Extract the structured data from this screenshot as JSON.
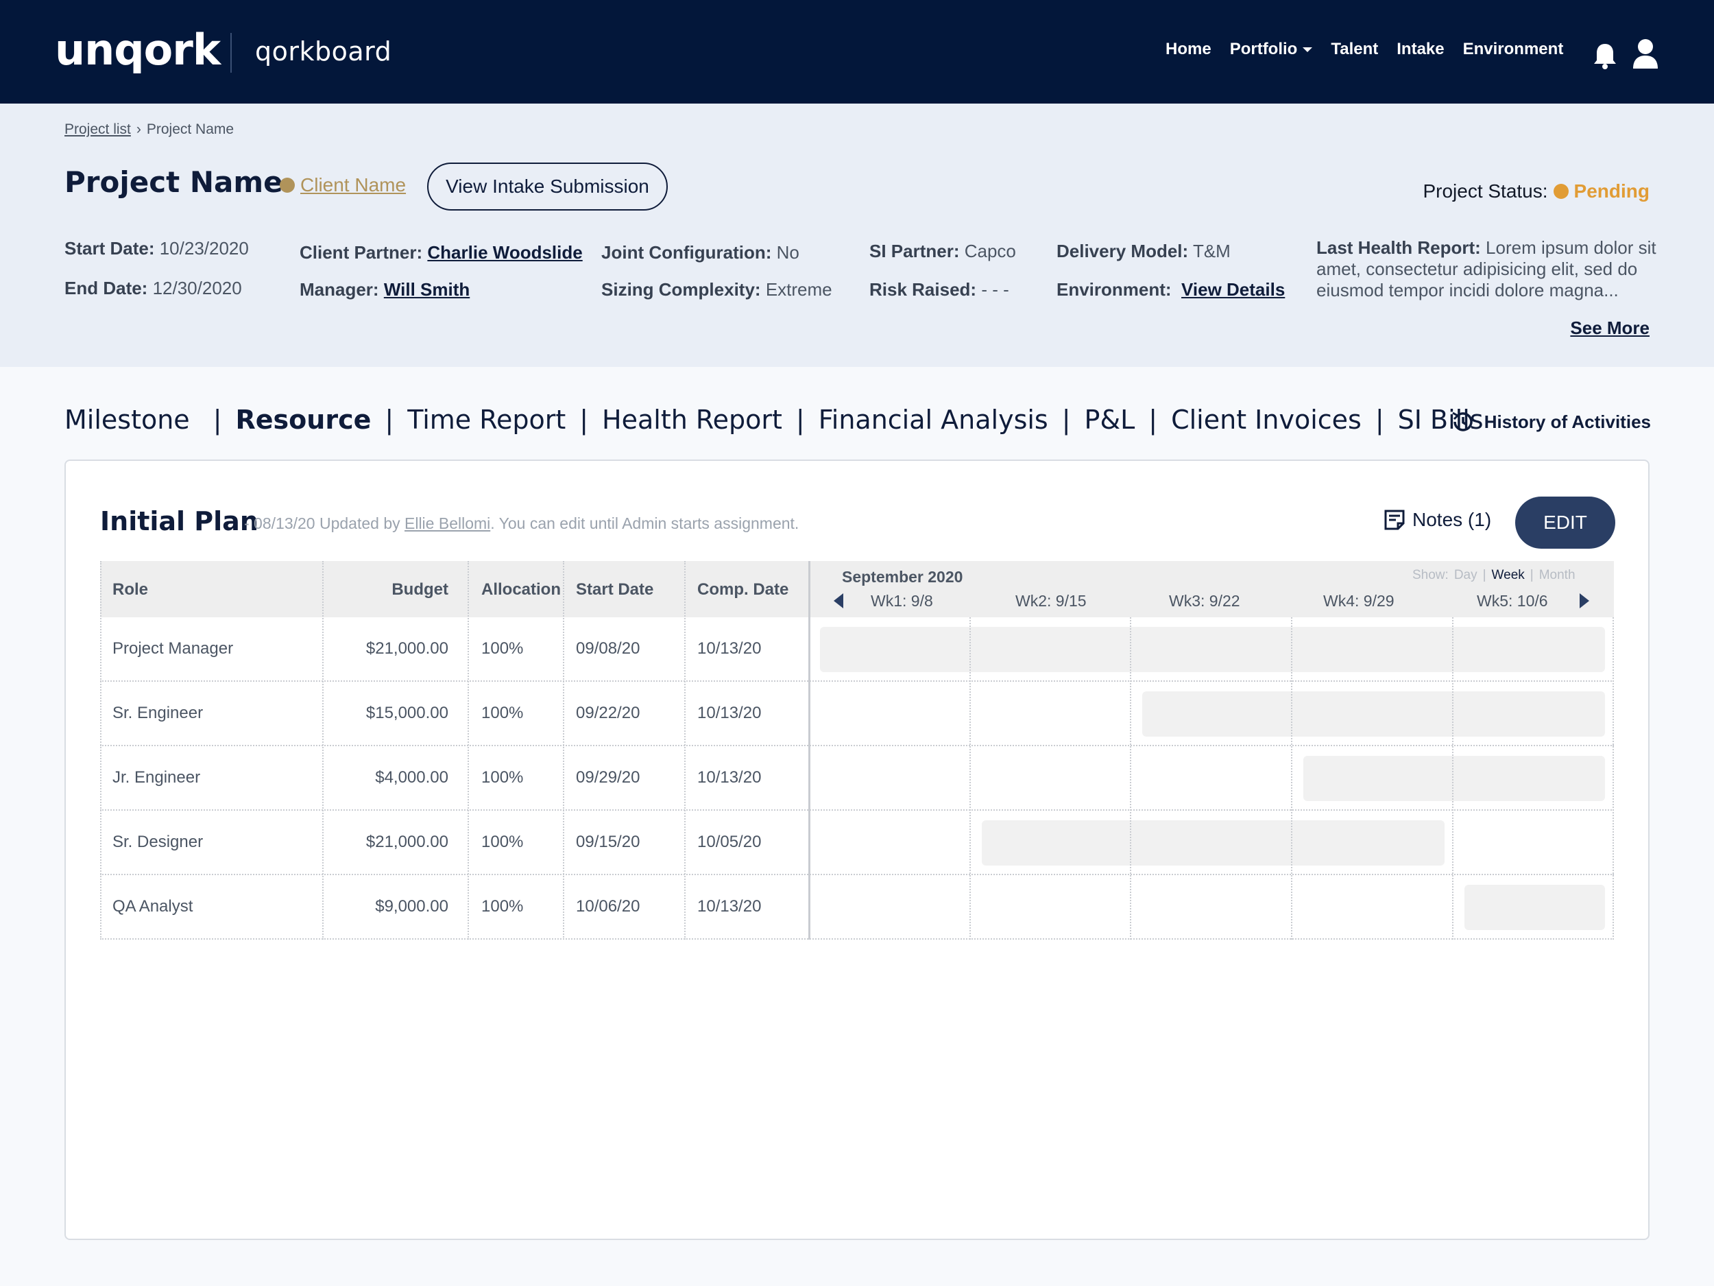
{
  "brand": {
    "logo": "unqork",
    "product": "qorkboard"
  },
  "nav": {
    "items": [
      {
        "label": "Home"
      },
      {
        "label": "Portfolio"
      },
      {
        "label": "Talent"
      },
      {
        "label": "Intake"
      },
      {
        "label": "Environment"
      }
    ]
  },
  "breadcrumb": {
    "parent": "Project list",
    "separator": "›",
    "current": "Project Name"
  },
  "project": {
    "title": "Project Name",
    "client": "Client Name",
    "intake_button": "View Intake Submission",
    "status_label": "Project Status:",
    "status_value": "Pending",
    "colors": {
      "client": "#b0935a",
      "pending": "#e19c35",
      "navy": "#03173a"
    }
  },
  "meta": {
    "start_label": "Start Date:",
    "start_value": "10/23/2020",
    "end_label": "End Date:",
    "end_value": "12/30/2020",
    "partner_label": "Client Partner:",
    "partner_value": "Charlie Woodslide",
    "manager_label": "Manager:",
    "manager_value": "Will Smith",
    "joint_label": "Joint Configuration:",
    "joint_value": "No",
    "sizing_label": "Sizing Complexity:",
    "sizing_value": "Extreme",
    "si_label": "SI Partner:",
    "si_value": "Capco",
    "risk_label": "Risk Raised:",
    "risk_value": "- - -",
    "delivery_label": "Delivery Model:",
    "delivery_value": "T&M",
    "env_label": "Environment:",
    "env_value": "View Details",
    "health_label": "Last Health Report:",
    "health_value": "Lorem ipsum dolor sit amet, consectetur adipisicing elit, sed do eiusmod tempor incidi dolore magna...",
    "see_more": "See More"
  },
  "tabs": {
    "items": [
      {
        "label": "Milestone"
      },
      {
        "label": "Resource"
      },
      {
        "label": "Time Report"
      },
      {
        "label": "Health Report"
      },
      {
        "label": "Financial Analysis"
      },
      {
        "label": "P&L"
      },
      {
        "label": "Client Invoices"
      },
      {
        "label": "SI Bills"
      }
    ],
    "active": "Resource",
    "separator": "|",
    "history": "History of Activities"
  },
  "plan": {
    "title": "Initial Plan",
    "sub_prefix": "- 08/13/20 Updated by",
    "sub_user": "Ellie Bellomi",
    "sub_suffix": ". You can edit until Admin starts assignment.",
    "notes": "Notes (1)",
    "edit": "EDIT"
  },
  "table": {
    "headers": [
      "Role",
      "Budget",
      "Allocation",
      "Start Date",
      "Comp. Date"
    ],
    "month": "September 2020",
    "show_label": "Show:",
    "views": [
      "Day",
      "Week",
      "Month"
    ],
    "view_separator": "|",
    "active_view": "Week",
    "weeks": [
      "Wk1: 9/8",
      "Wk2: 9/15",
      "Wk3: 9/22",
      "Wk4: 9/29",
      "Wk5: 10/6"
    ],
    "rows": [
      {
        "role": "Project Manager",
        "budget": "$21,000.00",
        "allocation": "100%",
        "start": "09/08/20",
        "comp": "10/13/20"
      },
      {
        "role": "Sr. Engineer",
        "budget": "$15,000.00",
        "allocation": "100%",
        "start": "09/22/20",
        "comp": "10/13/20"
      },
      {
        "role": "Jr. Engineer",
        "budget": "$4,000.00",
        "allocation": "100%",
        "start": "09/29/20",
        "comp": "10/13/20"
      },
      {
        "role": "Sr. Designer",
        "budget": "$21,000.00",
        "allocation": "100%",
        "start": "09/15/20",
        "comp": "10/05/20"
      },
      {
        "role": "QA Analyst",
        "budget": "$9,000.00",
        "allocation": "100%",
        "start": "10/06/20",
        "comp": "10/13/20"
      }
    ]
  }
}
